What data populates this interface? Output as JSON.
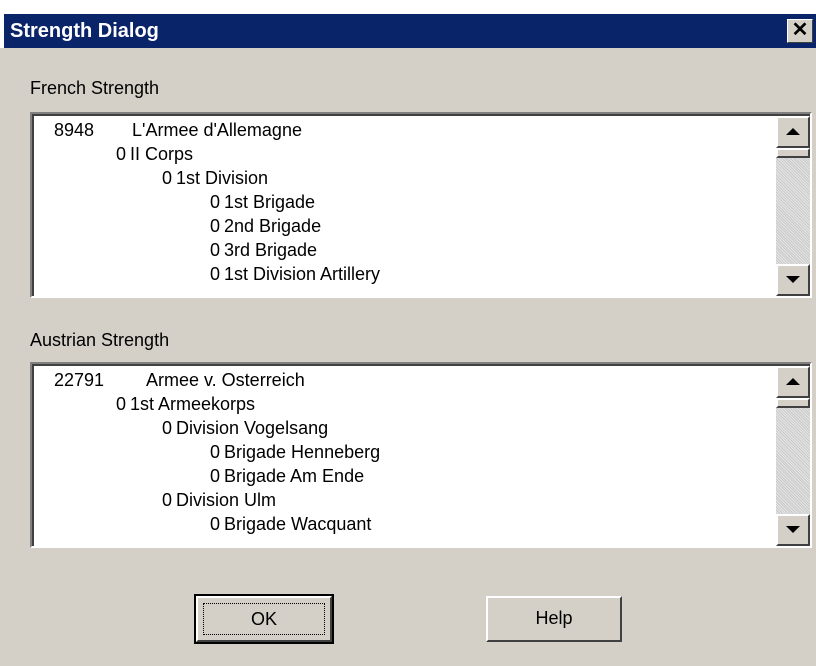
{
  "window": {
    "title": "Strength Dialog",
    "close_glyph": "✕"
  },
  "french": {
    "label": "French Strength",
    "rows": [
      {
        "value": "8948",
        "name": "L'Armee d'Allemagne",
        "level": 0
      },
      {
        "value": "0",
        "name": "II Corps",
        "level": 1
      },
      {
        "value": "0",
        "name": "1st Division",
        "level": 2
      },
      {
        "value": "0",
        "name": "1st Brigade",
        "level": 3
      },
      {
        "value": "0",
        "name": "2nd Brigade",
        "level": 3
      },
      {
        "value": "0",
        "name": "3rd Brigade",
        "level": 3
      },
      {
        "value": "0",
        "name": "1st Division Artillery",
        "level": 3
      }
    ]
  },
  "austrian": {
    "label": "Austrian Strength",
    "rows": [
      {
        "value": "22791",
        "name": "Armee v. Osterreich",
        "level": 0
      },
      {
        "value": "0",
        "name": "1st Armeekorps",
        "level": 1
      },
      {
        "value": "0",
        "name": "Division Vogelsang",
        "level": 2
      },
      {
        "value": "0",
        "name": "Brigade Henneberg",
        "level": 3
      },
      {
        "value": "0",
        "name": "Brigade Am Ende",
        "level": 3
      },
      {
        "value": "0",
        "name": "Division Ulm",
        "level": 2
      },
      {
        "value": "0",
        "name": "Brigade Wacquant",
        "level": 3
      }
    ]
  },
  "buttons": {
    "ok": "OK",
    "help": "Help"
  }
}
